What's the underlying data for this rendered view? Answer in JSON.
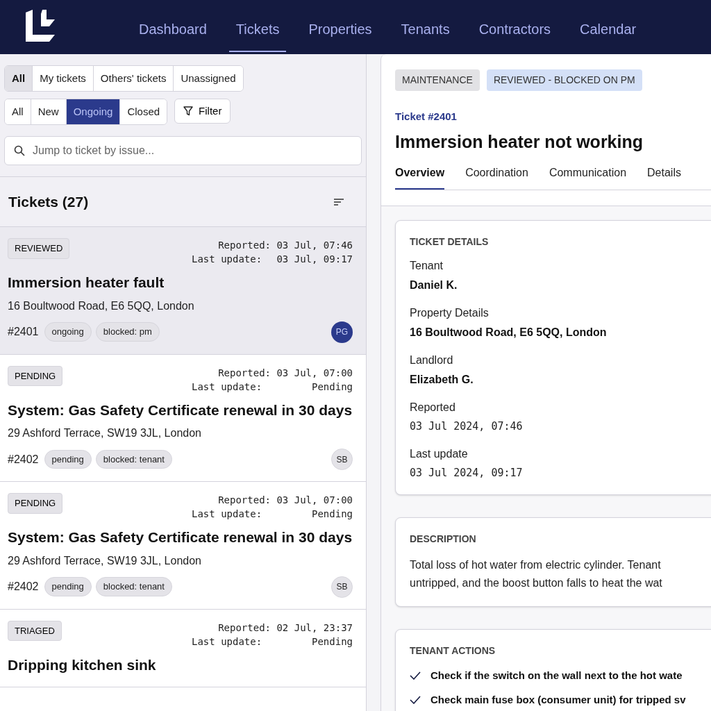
{
  "nav": {
    "items": [
      {
        "label": "Dashboard",
        "selected": false
      },
      {
        "label": "Tickets",
        "selected": true
      },
      {
        "label": "Properties",
        "selected": false
      },
      {
        "label": "Tenants",
        "selected": false
      },
      {
        "label": "Contractors",
        "selected": false
      },
      {
        "label": "Calendar",
        "selected": false
      }
    ]
  },
  "owner_filter": [
    {
      "label": "All",
      "selected": true
    },
    {
      "label": "My tickets",
      "selected": false
    },
    {
      "label": "Others' tickets",
      "selected": false
    },
    {
      "label": "Unassigned",
      "selected": false
    }
  ],
  "status_filter": [
    {
      "label": "All",
      "selected": false
    },
    {
      "label": "New",
      "selected": false
    },
    {
      "label": "Ongoing",
      "selected": true
    },
    {
      "label": "Closed",
      "selected": false
    }
  ],
  "filter_button": "Filter",
  "search": {
    "placeholder": "Jump to ticket by issue..."
  },
  "list_title": "Tickets (27)",
  "tickets": [
    {
      "status": "REVIEWED",
      "reported": "Reported: 03 Jul, 07:46",
      "last_label": "Last update:",
      "last_value": "03 Jul, 09:17",
      "title": "Immersion heater fault",
      "address": "16 Boultwood Road, E6 5QQ, London",
      "number": "#2401",
      "tags": [
        "ongoing",
        "blocked: pm"
      ],
      "assignee": "PG",
      "assignee_highlight": true,
      "selected": true
    },
    {
      "status": "PENDING",
      "reported": "Reported: 03 Jul, 07:00",
      "last_label": "Last update:",
      "last_value": "Pending",
      "title": "System: Gas Safety Certificate renewal in 30 days",
      "address": "29 Ashford Terrace, SW19 3JL, London",
      "number": "#2402",
      "tags": [
        "pending",
        "blocked: tenant"
      ],
      "assignee": "SB",
      "assignee_highlight": false,
      "selected": false
    },
    {
      "status": "PENDING",
      "reported": "Reported: 03 Jul, 07:00",
      "last_label": "Last update:",
      "last_value": "Pending",
      "title": "System: Gas Safety Certificate renewal in 30 days",
      "address": "29 Ashford Terrace, SW19 3JL, London",
      "number": "#2402",
      "tags": [
        "pending",
        "blocked: tenant"
      ],
      "assignee": "SB",
      "assignee_highlight": false,
      "selected": false
    },
    {
      "status": "TRIAGED",
      "reported": "Reported: 02 Jul, 23:37",
      "last_label": "Last update:",
      "last_value": "Pending",
      "title": "Dripping kitchen sink",
      "selected": false
    }
  ],
  "detail": {
    "badges": [
      {
        "label": "MAINTENANCE",
        "color": "#e2e2e5"
      },
      {
        "label": "REVIEWED - BLOCKED ON PM",
        "color": "#d4e0f7"
      }
    ],
    "ticket_ref": "Ticket #2401",
    "title": "Immersion heater not working",
    "tabs": [
      {
        "label": "Overview",
        "selected": true
      },
      {
        "label": "Coordination",
        "selected": false
      },
      {
        "label": "Communication",
        "selected": false
      },
      {
        "label": "Details",
        "selected": false
      }
    ],
    "ticket_details": {
      "heading": "TICKET DETAILS",
      "fields": [
        {
          "label": "Tenant",
          "value": "Daniel K.",
          "kind": "text"
        },
        {
          "label": "Property Details",
          "value": "16 Boultwood Road, E6 5QQ, London",
          "kind": "text"
        },
        {
          "label": "Landlord",
          "value": "Elizabeth G.",
          "kind": "text"
        },
        {
          "label": "Reported",
          "value": "03 Jul 2024, 07:46",
          "kind": "date"
        },
        {
          "label": "Last update",
          "value": "03 Jul 2024, 09:17",
          "kind": "date"
        }
      ]
    },
    "description": {
      "heading": "DESCRIPTION",
      "lines": [
        "Total loss of hot water from electric cylinder. Tenant",
        "untripped, and the boost button falls to heat the wat"
      ]
    },
    "tenant_actions": {
      "heading": "TENANT ACTIONS",
      "items": [
        {
          "text": "Check if the switch on the wall next to the hot wate",
          "checked": true
        },
        {
          "text": "Check main fuse box (consumer unit) for tripped sv",
          "checked": true
        }
      ]
    }
  }
}
